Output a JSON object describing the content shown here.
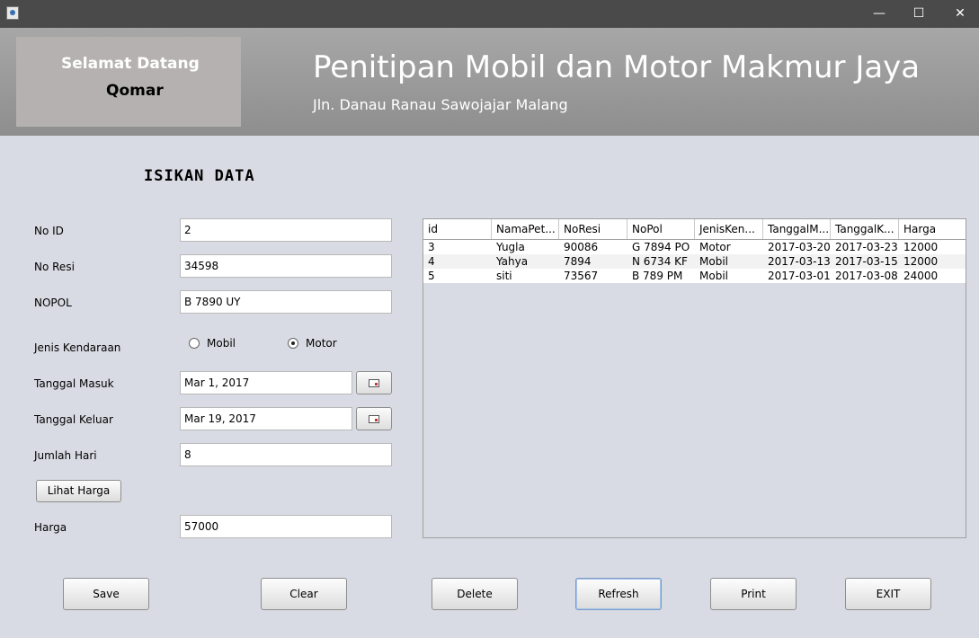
{
  "window": {
    "minimize_icon": "minimize-icon",
    "maximize_icon": "maximize-icon",
    "close_icon": "close-icon",
    "minimize_glyph": "—",
    "maximize_glyph": "☐",
    "close_glyph": "✕"
  },
  "header": {
    "welcome": "Selamat Datang",
    "user": "Qomar",
    "title": "Penitipan Mobil dan Motor Makmur Jaya",
    "subtitle": "Jln. Danau Ranau Sawojajar Malang"
  },
  "form": {
    "section_title": "ISIKAN DATA",
    "no_id_label": "No ID",
    "no_id_value": "2",
    "no_resi_label": "No Resi",
    "no_resi_value": "34598",
    "nopol_label": "NOPOL",
    "nopol_value": "B 7890 UY",
    "jenis_label": "Jenis Kendaraan",
    "jenis_options": [
      "Mobil",
      "Motor"
    ],
    "jenis_selected": "Motor",
    "tgl_masuk_label": "Tanggal Masuk",
    "tgl_masuk_value": "Mar 1, 2017",
    "tgl_keluar_label": "Tanggal Keluar",
    "tgl_keluar_value": "Mar 19, 2017",
    "jumlah_hari_label": "Jumlah Hari",
    "jumlah_hari_value": "8",
    "lihat_harga_label": "Lihat Harga",
    "harga_label": "Harga",
    "harga_value": "57000"
  },
  "table": {
    "columns": [
      "id",
      "NamaPet...",
      "NoResi",
      "NoPol",
      "JenisKen...",
      "TanggalM...",
      "TanggalK...",
      "Harga"
    ],
    "rows": [
      [
        "3",
        "Yugla",
        "90086",
        "G 7894 PO",
        "Motor",
        "2017-03-20",
        "2017-03-23",
        "12000"
      ],
      [
        "4",
        "Yahya",
        "7894",
        "N 6734 KF",
        "Mobil",
        "2017-03-13",
        "2017-03-15",
        "12000"
      ],
      [
        "5",
        "siti",
        "73567",
        "B 789 PM",
        "Mobil",
        "2017-03-01",
        "2017-03-08",
        "24000"
      ]
    ]
  },
  "actions": {
    "save": "Save",
    "clear": "Clear",
    "delete": "Delete",
    "refresh": "Refresh",
    "print": "Print",
    "exit": "EXIT"
  }
}
